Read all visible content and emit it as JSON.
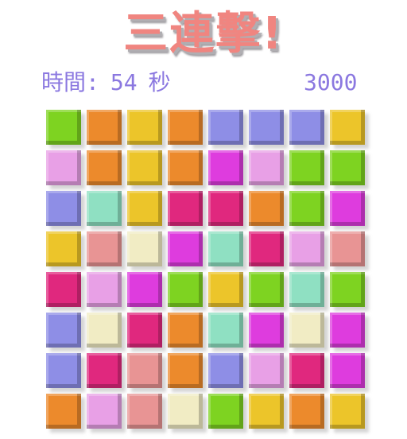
{
  "title": "三連擊!",
  "status": {
    "time_label": "時間:",
    "time_value": "54",
    "time_unit": "秒",
    "score": "3000"
  },
  "colors": {
    "G": "#7ed321",
    "O": "#ec8a2c",
    "Y": "#ecc52a",
    "P": "#8e8ee6",
    "L": "#e8a0e6",
    "M": "#de3cde",
    "T": "#8fe0c2",
    "R": "#e0287e",
    "S": "#e89494",
    "C": "#f1ecc4"
  },
  "board": {
    "rows": [
      [
        "G",
        "O",
        "Y",
        "O",
        "P",
        "P",
        "P",
        "Y"
      ],
      [
        "L",
        "O",
        "Y",
        "O",
        "M",
        "L",
        "G",
        "G"
      ],
      [
        "P",
        "T",
        "Y",
        "R",
        "R",
        "O",
        "G",
        "M"
      ],
      [
        "Y",
        "S",
        "C",
        "M",
        "T",
        "R",
        "L",
        "S"
      ],
      [
        "R",
        "L",
        "M",
        "G",
        "Y",
        "G",
        "T",
        "G"
      ],
      [
        "P",
        "C",
        "R",
        "O",
        "T",
        "M",
        "C",
        "M"
      ],
      [
        "P",
        "R",
        "S",
        "O",
        "P",
        "L",
        "R",
        "M"
      ],
      [
        "O",
        "L",
        "S",
        "C",
        "G",
        "Y",
        "O",
        "Y"
      ]
    ]
  }
}
